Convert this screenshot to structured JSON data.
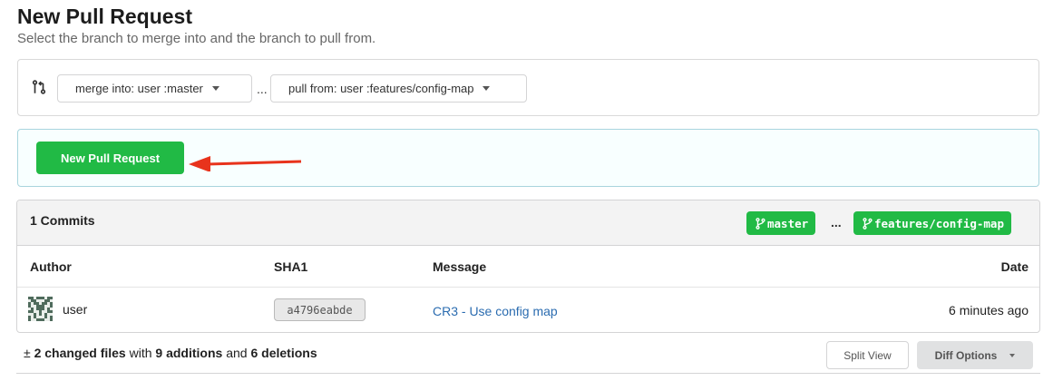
{
  "page": {
    "title": "New Pull Request",
    "subtitle": "Select the branch to merge into and the branch to pull from."
  },
  "compare": {
    "icon": "pull-request-compare-icon",
    "merge_into": "merge into: user  :master",
    "separator": "...",
    "pull_from": "pull from: user  :features/config-map"
  },
  "create": {
    "button_label": "New Pull Request",
    "button_color": "#21ba45",
    "annotation_color": "#e8331c"
  },
  "commits": {
    "count_label": "1 Commits",
    "base_branch": "master",
    "separator": "...",
    "head_branch": "features/config-map",
    "columns": {
      "author": "Author",
      "sha": "SHA1",
      "message": "Message",
      "date": "Date"
    },
    "rows": [
      {
        "author": "user",
        "sha": "a4796eabde",
        "message": "CR3 - Use config map",
        "date": "6 minutes ago"
      }
    ]
  },
  "diff": {
    "icon": "plus-minus-icon",
    "changed_files": "2 changed files",
    "with": " with ",
    "additions": "9 additions",
    "and": " and ",
    "deletions": "6 deletions",
    "split_view_label": "Split View",
    "diff_options_label": "Diff Options"
  }
}
